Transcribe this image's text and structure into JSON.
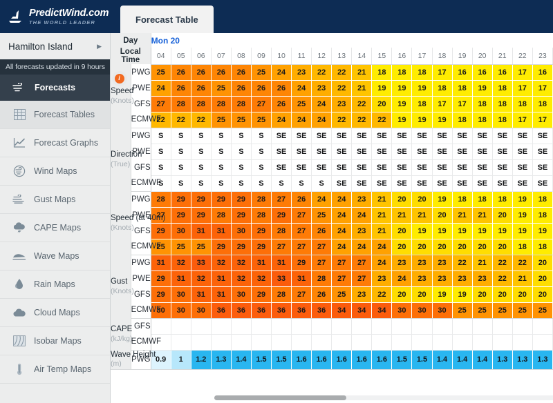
{
  "brand": {
    "name": "PredictWind.com",
    "tagline": "THE WORLD LEADER",
    "logo_icon": "sailboat-icon"
  },
  "tabs": [
    {
      "label": "Forecast Table",
      "active": true
    }
  ],
  "sidebar": {
    "location": {
      "name": "Hamilton Island",
      "arrow_icon": "chevron-right-icon"
    },
    "updated_notice": "All forecasts updated in 9 hours",
    "section_header": {
      "label": "Forecasts",
      "icon": "wind-icon"
    },
    "items": [
      {
        "label": "Forecast Tables",
        "icon": "table-grid-icon",
        "active": true
      },
      {
        "label": "Forecast Graphs",
        "icon": "line-chart-icon",
        "active": false
      },
      {
        "label": "Wind Maps",
        "icon": "wind-globe-icon",
        "active": false
      },
      {
        "label": "Gust Maps",
        "icon": "gust-icon",
        "active": false
      },
      {
        "label": "CAPE Maps",
        "icon": "thunderstorm-cloud-icon",
        "active": false
      },
      {
        "label": "Wave Maps",
        "icon": "wave-icon",
        "active": false
      },
      {
        "label": "Rain Maps",
        "icon": "raindrop-icon",
        "active": false
      },
      {
        "label": "Cloud Maps",
        "icon": "cloud-icon",
        "active": false
      },
      {
        "label": "Isobar Maps",
        "icon": "isobar-icon",
        "active": false
      },
      {
        "label": "Air Temp Maps",
        "icon": "thermometer-icon",
        "active": false
      }
    ]
  },
  "table": {
    "row_labels": {
      "day": "Day",
      "local_time": "Local Time"
    },
    "day": "Mon 20",
    "times": [
      "04",
      "05",
      "06",
      "07",
      "08",
      "09",
      "10",
      "11",
      "12",
      "13",
      "14",
      "15",
      "16",
      "17",
      "18",
      "19",
      "20",
      "21",
      "22",
      "23"
    ],
    "groups": [
      {
        "name": "Speed",
        "unit": "(Knots)",
        "info_icon": "info-icon",
        "kind": "speed",
        "rows": [
          {
            "model": "PWG",
            "values": [
              25,
              26,
              26,
              26,
              26,
              25,
              24,
              23,
              22,
              22,
              21,
              18,
              18,
              18,
              17,
              16,
              16,
              16,
              17,
              16
            ]
          },
          {
            "model": "PWE",
            "values": [
              24,
              26,
              26,
              25,
              26,
              26,
              26,
              24,
              23,
              22,
              21,
              19,
              19,
              19,
              18,
              18,
              19,
              18,
              17,
              17
            ]
          },
          {
            "model": "GFS",
            "values": [
              27,
              28,
              28,
              28,
              28,
              27,
              26,
              25,
              24,
              23,
              22,
              20,
              19,
              18,
              17,
              17,
              18,
              18,
              18,
              18
            ]
          },
          {
            "model": "ECMWF",
            "values": [
              22,
              22,
              22,
              25,
              25,
              25,
              24,
              24,
              24,
              22,
              22,
              22,
              19,
              19,
              19,
              18,
              18,
              18,
              17,
              17
            ]
          }
        ]
      },
      {
        "name": "Direction",
        "unit": "(True)",
        "kind": "direction",
        "rows": [
          {
            "model": "PWG",
            "values": [
              "S",
              "S",
              "S",
              "S",
              "S",
              "S",
              "SE",
              "SE",
              "SE",
              "SE",
              "SE",
              "SE",
              "SE",
              "SE",
              "SE",
              "SE",
              "SE",
              "SE",
              "SE",
              "SE"
            ]
          },
          {
            "model": "PWE",
            "values": [
              "S",
              "S",
              "S",
              "S",
              "S",
              "S",
              "SE",
              "SE",
              "SE",
              "SE",
              "SE",
              "SE",
              "SE",
              "SE",
              "SE",
              "SE",
              "SE",
              "SE",
              "SE",
              "SE"
            ]
          },
          {
            "model": "GFS",
            "values": [
              "S",
              "S",
              "S",
              "S",
              "S",
              "S",
              "SE",
              "SE",
              "SE",
              "SE",
              "SE",
              "SE",
              "SE",
              "SE",
              "SE",
              "SE",
              "SE",
              "SE",
              "SE",
              "SE"
            ]
          },
          {
            "model": "ECMWF",
            "values": [
              "S",
              "S",
              "S",
              "S",
              "S",
              "S",
              "S",
              "S",
              "S",
              "SE",
              "SE",
              "SE",
              "SE",
              "SE",
              "SE",
              "SE",
              "SE",
              "SE",
              "SE",
              "SE"
            ]
          }
        ]
      },
      {
        "name": "Speed (at 40m)",
        "unit": "(Knots)",
        "kind": "speed",
        "rows": [
          {
            "model": "PWG",
            "values": [
              28,
              29,
              29,
              29,
              29,
              28,
              27,
              26,
              24,
              24,
              23,
              21,
              20,
              20,
              19,
              18,
              18,
              18,
              19,
              18
            ]
          },
          {
            "model": "PWE",
            "values": [
              27,
              29,
              29,
              28,
              29,
              28,
              29,
              27,
              25,
              24,
              24,
              21,
              21,
              21,
              20,
              21,
              21,
              20,
              19,
              18
            ]
          },
          {
            "model": "GFS",
            "values": [
              29,
              30,
              31,
              31,
              30,
              29,
              28,
              27,
              26,
              24,
              23,
              21,
              20,
              19,
              19,
              19,
              19,
              19,
              19,
              19
            ]
          },
          {
            "model": "ECMWF",
            "values": [
              25,
              25,
              25,
              29,
              29,
              29,
              27,
              27,
              27,
              24,
              24,
              24,
              20,
              20,
              20,
              20,
              20,
              20,
              18,
              18
            ]
          }
        ]
      },
      {
        "name": "Gust",
        "unit": "(Knots)",
        "kind": "speed",
        "rows": [
          {
            "model": "PWG",
            "values": [
              31,
              32,
              33,
              32,
              32,
              31,
              31,
              29,
              27,
              27,
              27,
              24,
              23,
              23,
              23,
              22,
              21,
              22,
              22,
              20
            ]
          },
          {
            "model": "PWE",
            "values": [
              29,
              31,
              32,
              31,
              32,
              32,
              33,
              31,
              28,
              27,
              27,
              23,
              24,
              23,
              23,
              23,
              23,
              22,
              21,
              20
            ]
          },
          {
            "model": "GFS",
            "values": [
              29,
              30,
              31,
              31,
              30,
              29,
              28,
              27,
              26,
              25,
              23,
              22,
              20,
              20,
              19,
              19,
              20,
              20,
              20,
              20
            ]
          },
          {
            "model": "ECMWF",
            "values": [
              30,
              30,
              30,
              36,
              36,
              36,
              36,
              36,
              36,
              34,
              34,
              34,
              30,
              30,
              30,
              25,
              25,
              25,
              25,
              25
            ]
          }
        ]
      },
      {
        "name": "CAPE",
        "unit": "(kJ/kg)",
        "kind": "blank",
        "rows": [
          {
            "model": "GFS",
            "values": [
              "",
              "",
              "",
              "",
              "",
              "",
              "",
              "",
              "",
              "",
              "",
              "",
              "",
              "",
              "",
              "",
              "",
              "",
              "",
              ""
            ]
          },
          {
            "model": "ECMWF",
            "values": [
              "",
              "",
              "",
              "",
              "",
              "",
              "",
              "",
              "",
              "",
              "",
              "",
              "",
              "",
              "",
              "",
              "",
              "",
              "",
              ""
            ]
          }
        ]
      },
      {
        "name": "Wave Height",
        "unit": "(m)",
        "kind": "wave",
        "rows": [
          {
            "model": "PWG",
            "values": [
              "0.9",
              "1",
              "1.2",
              "1.3",
              "1.4",
              "1.5",
              "1.5",
              "1.6",
              "1.6",
              "1.6",
              "1.6",
              "1.6",
              "1.5",
              "1.5",
              "1.4",
              "1.4",
              "1.4",
              "1.3",
              "1.3",
              "1.3"
            ]
          }
        ]
      }
    ]
  },
  "colors": {
    "brand_navy": "#0d2c54",
    "accent_blue": "#1560d8",
    "info_orange": "#f26a21",
    "wave_blue": "#29b6f0",
    "wave_blue_light": "#bfe9fb",
    "sidebar_bg": "#eceded",
    "scale": {
      "yellow": "#ffec00",
      "yellow_amber": "#ffd500",
      "amber": "#ffb400",
      "orange": "#ff9000",
      "orange_deep": "#ff7900",
      "orange_red": "#fc5d0d",
      "red_orange": "#f44c0a"
    }
  },
  "scrollbar": {
    "thumb_position_percent": 0,
    "thumb_width_percent": 30
  }
}
